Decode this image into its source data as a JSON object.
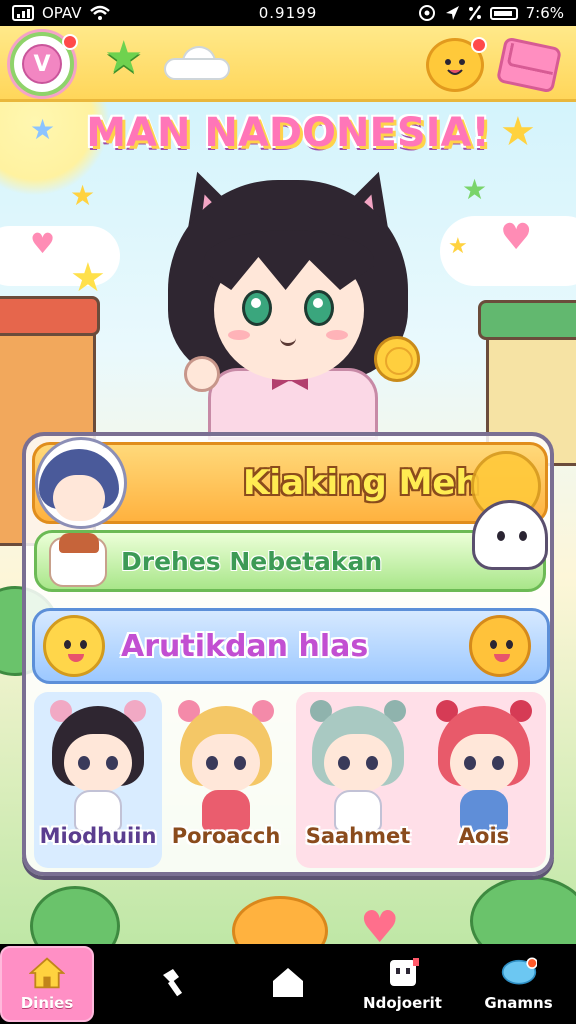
{
  "status_bar": {
    "carrier": "OPAV",
    "center": "0.9199",
    "battery_pct": "7:6%"
  },
  "header": {
    "avatar_letter": "V",
    "title": "MAN NADONESIA!"
  },
  "menu": {
    "item1_label": "Kiaking Meh",
    "item2_label": "Drehes Nebetakan",
    "item3_label": "Arutikdan hlas"
  },
  "characters": [
    {
      "name": "Miodhuiin",
      "hair": "#2f2631",
      "accent": "#f1a9c4",
      "outfit": "#ffffff"
    },
    {
      "name": "Poroacch",
      "hair": "#f4c766",
      "accent": "#f48aa9",
      "outfit": "#ea5d6e"
    },
    {
      "name": "Saahmet",
      "hair": "#a9c9c2",
      "accent": "#8fb3ad",
      "outfit": "#ffffff"
    },
    {
      "name": "Aois",
      "hair": "#e85a6a",
      "accent": "#d63b55",
      "outfit": "#5f8ed8"
    }
  ],
  "bottom_nav": {
    "home_label": "Dinies",
    "item2_label": "",
    "item3_label": "",
    "item4_label": "Ndojoerit",
    "item5_label": "Gnamns"
  },
  "icons": {
    "signal": "signal-icon",
    "wifi": "wifi-icon",
    "battery": "battery-icon",
    "star": "star-icon",
    "cloud": "cloud-icon",
    "bear": "bear-icon",
    "mail": "mail-icon",
    "home": "home-icon"
  },
  "colors": {
    "top_bar": "#ffd65a",
    "title_pink": "#ff76b8",
    "orange_button": "#ffb23f",
    "green_button": "#a9e68a",
    "blue_button": "#9cc8ff",
    "nav_home": "#ff8fc5"
  }
}
